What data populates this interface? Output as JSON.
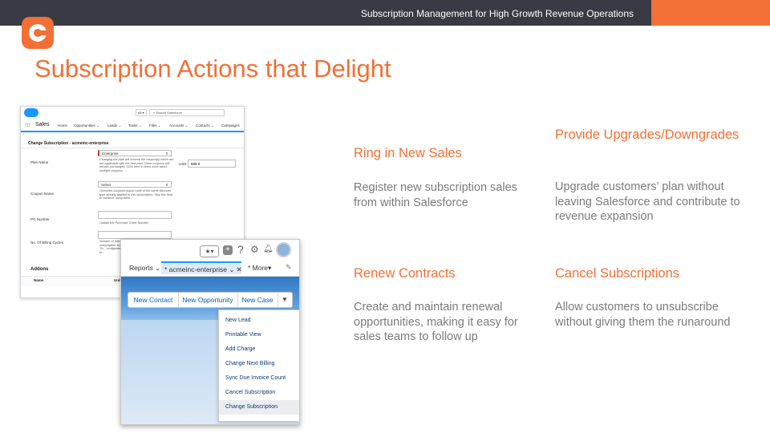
{
  "header": {
    "title": "Subscription Management for High Growth Revenue Operations",
    "colors": {
      "bar": "#3a3a44",
      "accent": "#f26f36"
    }
  },
  "logo": {
    "icon": "chargebee-c-logo-icon"
  },
  "slide": {
    "heading": "Subscription Actions that Delight"
  },
  "salesforce": {
    "search_scope": "All",
    "search_placeholder": "Search Salesforce",
    "app_name": "Sales",
    "nav": [
      "Home",
      "Opportunities",
      "Leads",
      "Tasks",
      "Files",
      "Accounts",
      "Contacts",
      "Campaigns"
    ],
    "page_title": "Change Subscription - acmeinc-enterprise",
    "plan_label": "Plan Name",
    "plan_value": "Enterprise",
    "plan_note": "Changing the plan will remove the coupon(s) which are not applicable with the new plan. Other coupons will remain unchanged. Click here to learn more about multiple coupons.",
    "currency": "USD",
    "amount": "699.0",
    "coupon_label": "Coupon Name",
    "coupon_value": "Select",
    "coupon_note": "Overrides coupon/coupon code of the same discount type already applied to this subscription. Skip this field to continue using them.",
    "po_label": "PO Number",
    "po_note": "Update the Purchase Order Number.",
    "billing_label": "No. Of Billing Cycles",
    "billing_note": "Number of billing cycles the subscription should be charged. Th... configured for... don't want to...",
    "addons_label": "Addons",
    "col_name": "Name",
    "col_unit": "Unit"
  },
  "actions_panel": {
    "tabs": [
      "Reports",
      "* acmeinc-enterprise",
      "* More"
    ],
    "buttons": [
      "New Contact",
      "New Opportunity",
      "New Case"
    ],
    "menu": [
      "New Lead",
      "Printable View",
      "Add Charge",
      "Change Next Billing",
      "Sync Due Invoice Count",
      "Cancel Subscription",
      "Change Subscription"
    ],
    "highlighted_item": "Change Subscription"
  },
  "features": [
    {
      "title": "Ring in New Sales",
      "desc": "Register new subscription sales from within Salesforce"
    },
    {
      "title": "Provide Upgrades/Downgrades",
      "desc": "Upgrade customers’ plan without leaving Salesforce and contribute to revenue expansion"
    },
    {
      "title": "Renew Contracts",
      "desc": "Create and maintain renewal opportunities, making it easy for sales teams to follow up"
    },
    {
      "title": "Cancel Subscriptions",
      "desc": "Allow customers to unsubscribe without giving them the runaround"
    }
  ]
}
